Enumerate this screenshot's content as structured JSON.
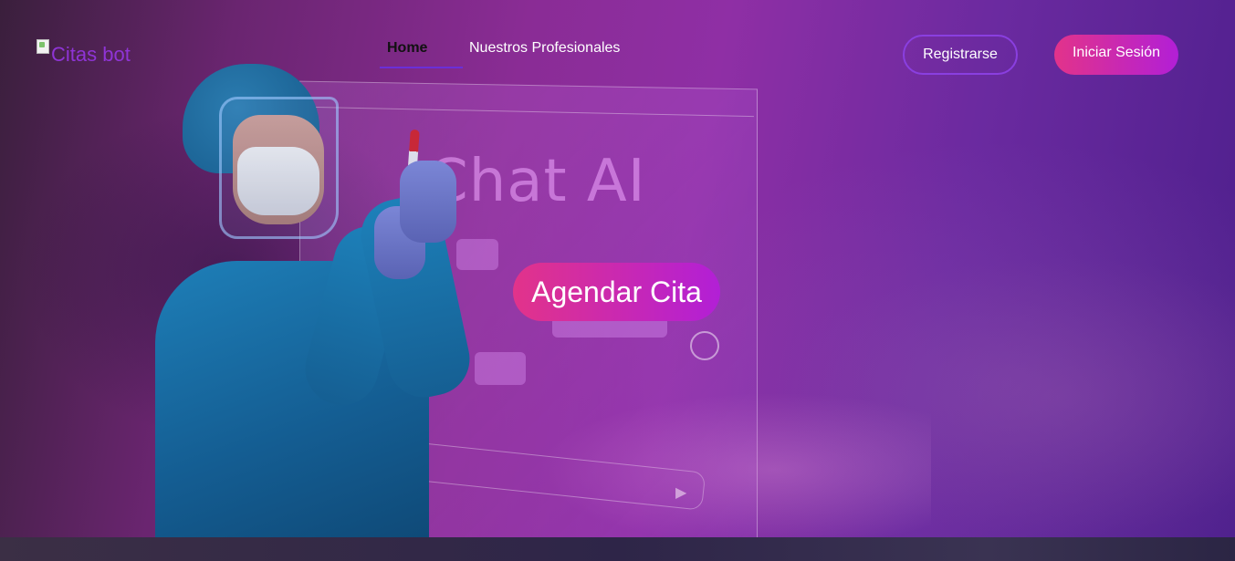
{
  "brand": {
    "logo_alt": "Citas bot"
  },
  "nav": {
    "home_label": "Home",
    "professionals_label": "Nuestros Profesionales"
  },
  "auth": {
    "register_label": "Registrarse",
    "login_label": "Iniciar Sesión"
  },
  "hero": {
    "background_text": "Chat AI",
    "cta_label": "Agendar Cita"
  },
  "colors": {
    "accent_purple": "#8a3fe0",
    "gradient_pink": "#e2338a",
    "gradient_violet": "#b21fd6"
  }
}
